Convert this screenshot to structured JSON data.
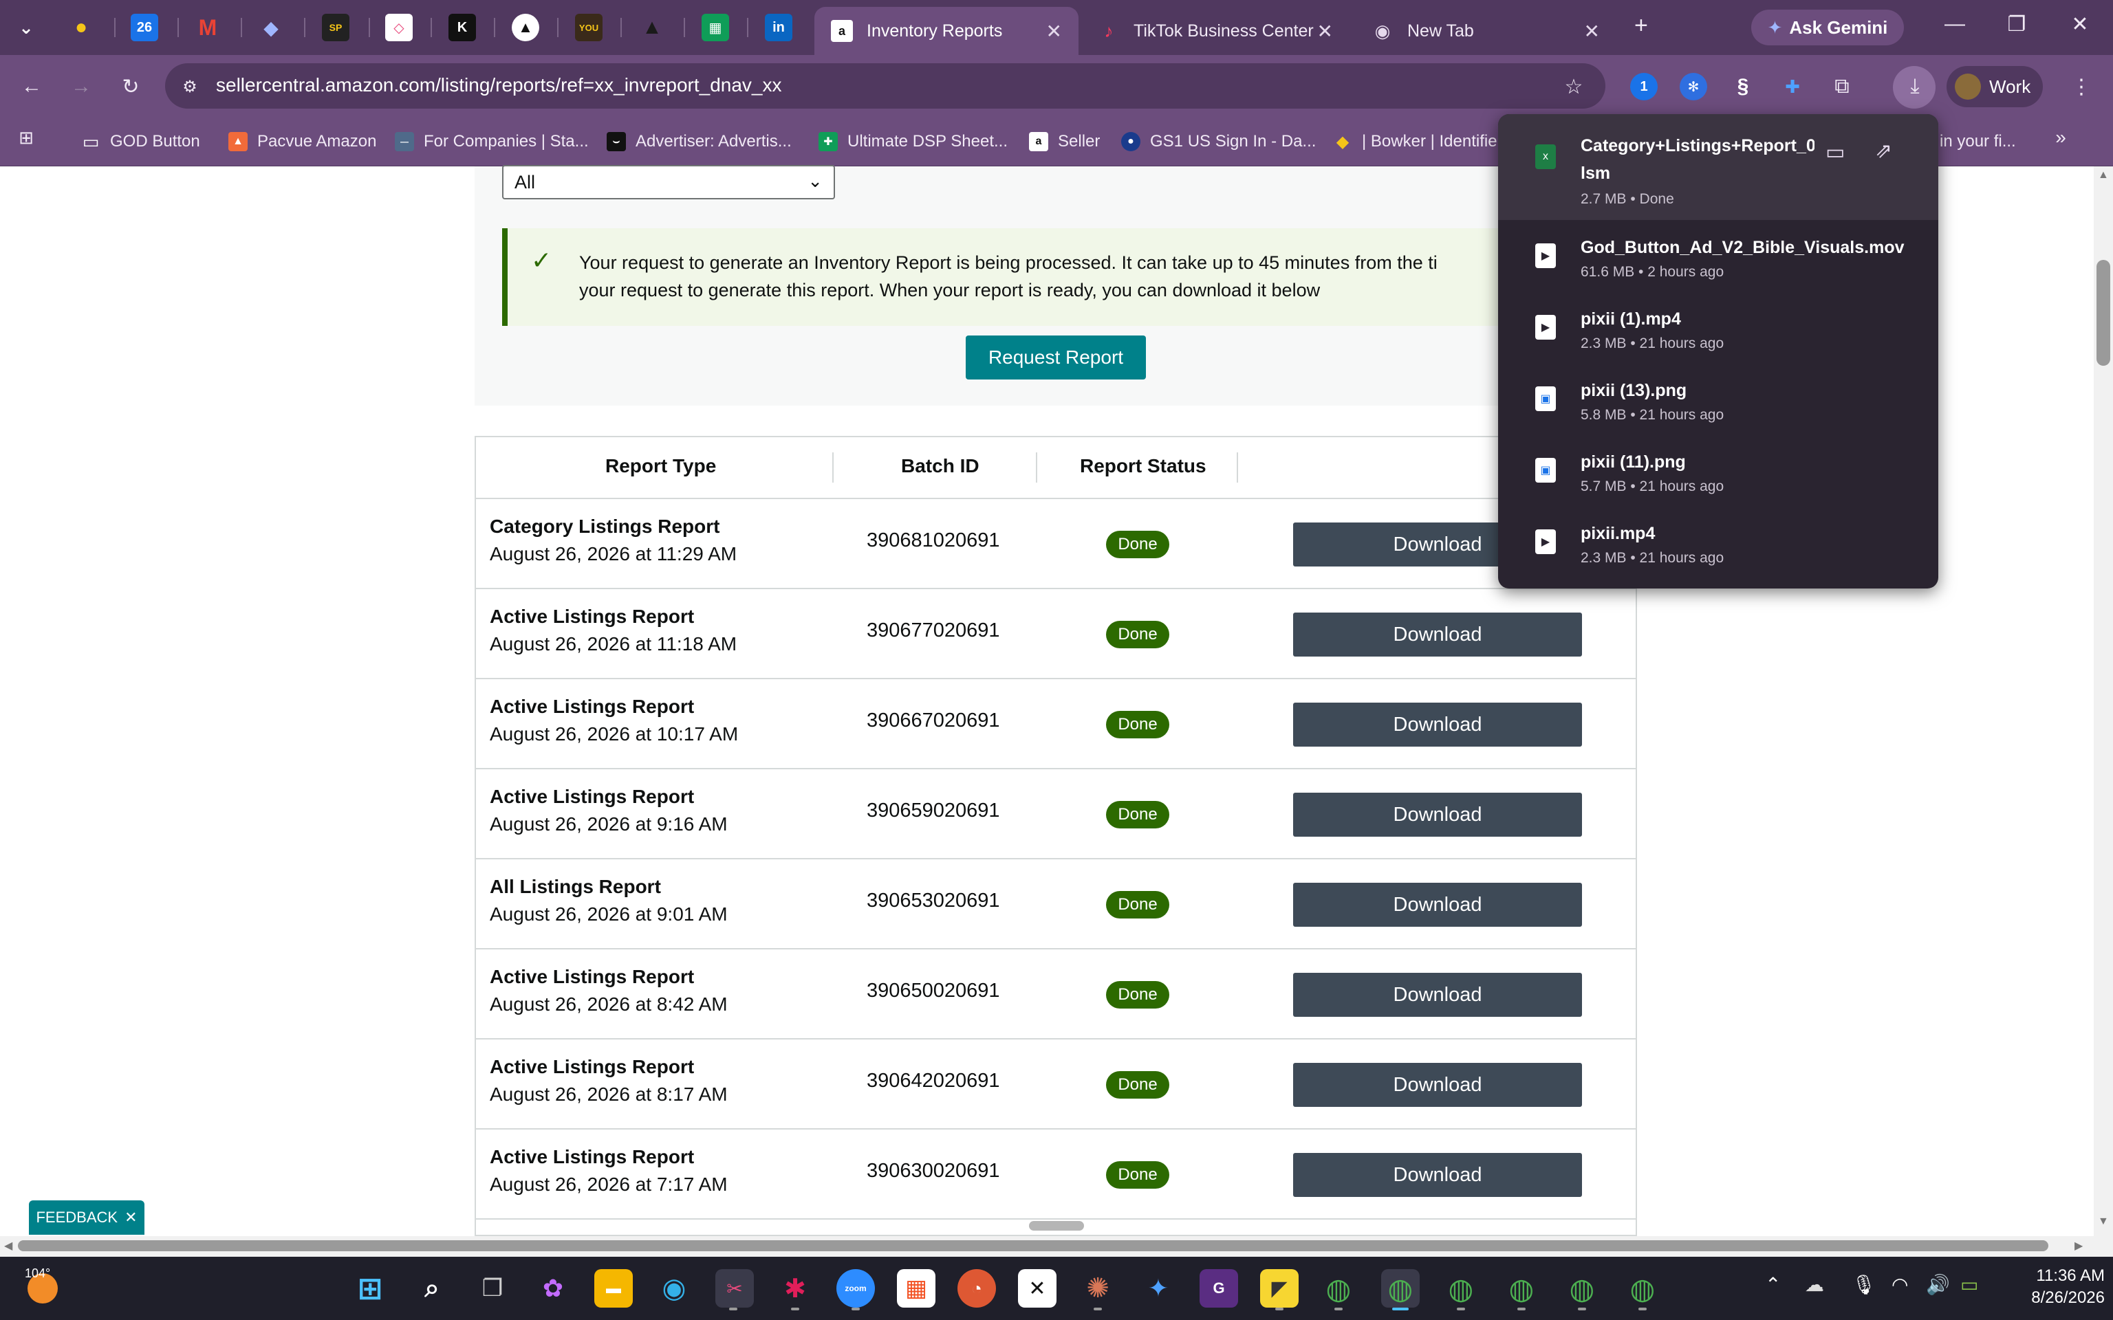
{
  "browser": {
    "tabs": [
      {
        "label": "Inventory Reports",
        "active": true
      },
      {
        "label": "TikTok Business Center",
        "active": false
      },
      {
        "label": "New Tab",
        "active": false
      }
    ],
    "pinned_tab_icons": [
      "bulb-icon",
      "calendar-icon",
      "gmail-icon",
      "diamond-icon",
      "sp-icon",
      "clickup-icon",
      "k-icon",
      "triangle-icon",
      "cinema-icon",
      "arrow-icon",
      "sheets-icon",
      "linkedin-icon"
    ],
    "pinned_badges": {
      "calendar": "26",
      "sp": "SP",
      "k": "K",
      "cinema": "YOU",
      "linkedin": "in"
    },
    "ask_gemini": "Ask Gemini",
    "url": "sellercentral.amazon.com/listing/reports/ref=xx_invreport_dnav_xx",
    "profile": "Work"
  },
  "bookmarks": [
    "GOD Button",
    "Pacvue Amazon",
    "For Companies | Sta...",
    "Advertiser: Advertis...",
    "Ultimate DSP Sheet...",
    "Seller",
    "GS1 US Sign In - Da...",
    "| Bowker | Identifie",
    "in your fi..."
  ],
  "page": {
    "filter_value": "All",
    "banner_line1": "Your request to generate an Inventory Report is being processed. It can take up to 45 minutes from the ti",
    "banner_line2": "your request to generate this report. When your report is ready, you can download it below",
    "request_button": "Request Report",
    "columns": [
      "Report Type",
      "Batch ID",
      "Report Status"
    ],
    "rows": [
      {
        "type": "Category Listings Report",
        "date": "August 26, 2026 at 11:29 AM",
        "batch": "390681020691",
        "status": "Done",
        "action": "Download"
      },
      {
        "type": "Active Listings Report",
        "date": "August 26, 2026 at 11:18 AM",
        "batch": "390677020691",
        "status": "Done",
        "action": "Download"
      },
      {
        "type": "Active Listings Report",
        "date": "August 26, 2026 at 10:17 AM",
        "batch": "390667020691",
        "status": "Done",
        "action": "Download"
      },
      {
        "type": "Active Listings Report",
        "date": "August 26, 2026 at 9:16 AM",
        "batch": "390659020691",
        "status": "Done",
        "action": "Download"
      },
      {
        "type": "All Listings Report",
        "date": "August 26, 2026 at 9:01 AM",
        "batch": "390653020691",
        "status": "Done",
        "action": "Download"
      },
      {
        "type": "Active Listings Report",
        "date": "August 26, 2026 at 8:42 AM",
        "batch": "390650020691",
        "status": "Done",
        "action": "Download"
      },
      {
        "type": "Active Listings Report",
        "date": "August 26, 2026 at 8:17 AM",
        "batch": "390642020691",
        "status": "Done",
        "action": "Download"
      },
      {
        "type": "Active Listings Report",
        "date": "August 26, 2026 at 7:17 AM",
        "batch": "390630020691",
        "status": "Done",
        "action": "Download"
      }
    ],
    "feedback": "FEEDBACK"
  },
  "downloads": [
    {
      "name": "Category+Listings+Report_0",
      "name2": "lsm",
      "meta": "2.7 MB • Done"
    },
    {
      "name": "God_Button_Ad_V2_Bible_Visuals.mov",
      "meta": "61.6 MB • 2 hours ago"
    },
    {
      "name": "pixii (1).mp4",
      "meta": "2.3 MB • 21 hours ago"
    },
    {
      "name": "pixii (13).png",
      "meta": "5.8 MB • 21 hours ago"
    },
    {
      "name": "pixii (11).png",
      "meta": "5.7 MB • 21 hours ago"
    },
    {
      "name": "pixii.mp4",
      "meta": "2.3 MB • 21 hours ago"
    }
  ],
  "taskbar": {
    "weather": "104°",
    "time": "11:36 AM",
    "date": "8/26/2026"
  },
  "colors": {
    "browser_frame": "#6c4d7d",
    "amazon_teal": "#00818a",
    "done_green": "#2c6a00",
    "download_button": "#3e4a57"
  }
}
